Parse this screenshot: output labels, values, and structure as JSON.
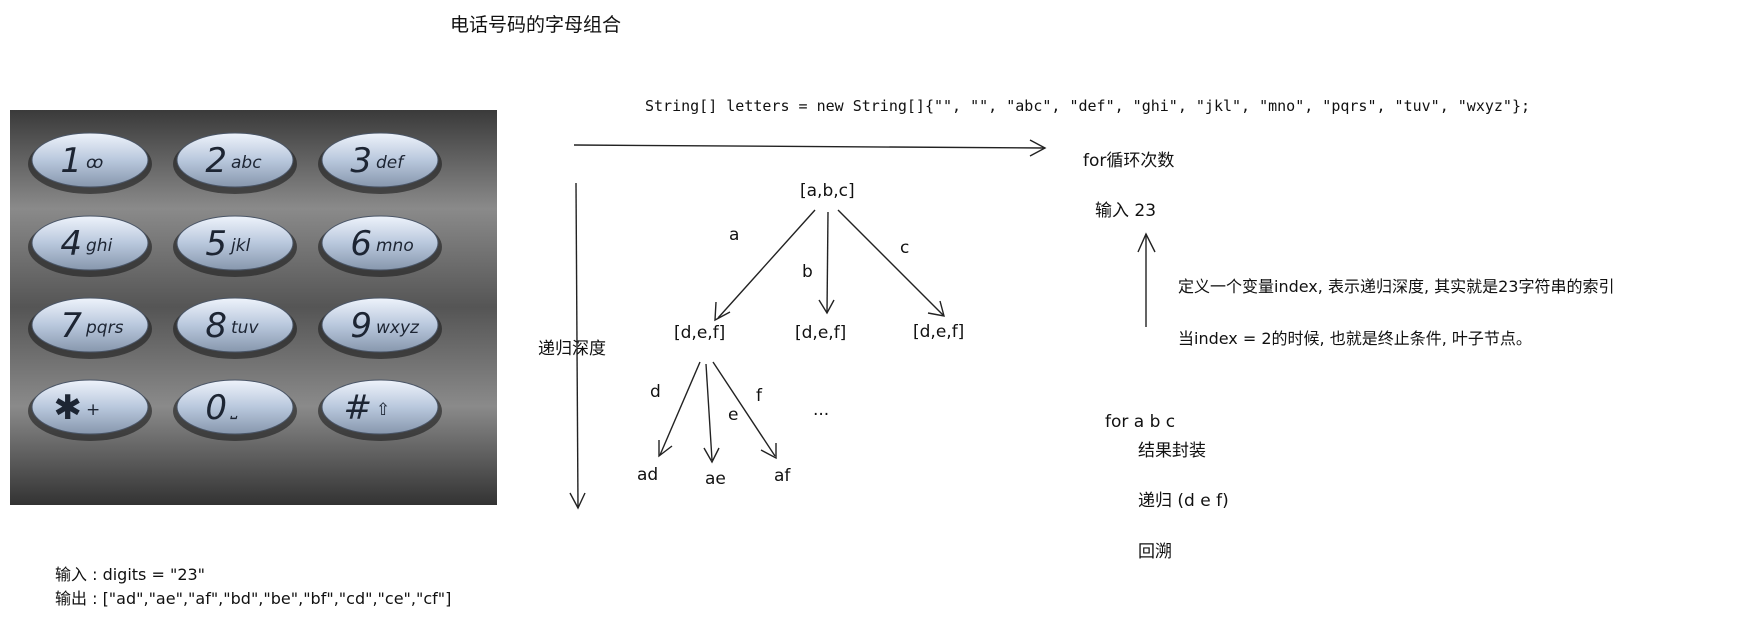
{
  "title": "电话号码的字母组合",
  "code_line": "String[] letters = new String[]{\"\", \"\", \"abc\", \"def\", \"ghi\", \"jkl\", \"mno\", \"pqrs\", \"tuv\", \"wxyz\"};",
  "loop_label": "for循环次数",
  "depth_label": "递归深度",
  "keypad": [
    {
      "digit": "1",
      "sub": "ꝏ"
    },
    {
      "digit": "2",
      "sub": "abc"
    },
    {
      "digit": "3",
      "sub": "def"
    },
    {
      "digit": "4",
      "sub": "ghi"
    },
    {
      "digit": "5",
      "sub": "jkl"
    },
    {
      "digit": "6",
      "sub": "mno"
    },
    {
      "digit": "7",
      "sub": "pqrs"
    },
    {
      "digit": "8",
      "sub": "tuv"
    },
    {
      "digit": "9",
      "sub": "wxyz"
    },
    {
      "digit": "✱",
      "sub": "+"
    },
    {
      "digit": "0",
      "sub": "⎵"
    },
    {
      "digit": "#",
      "sub": "⇧"
    }
  ],
  "tree": {
    "root": "[a,b,c]",
    "level1_edges": [
      "a",
      "b",
      "c"
    ],
    "level1_nodes": [
      "[d,e,f]",
      "[d,e,f]",
      "[d,e,f]"
    ],
    "level2_edges": [
      "d",
      "e",
      "f"
    ],
    "level2_nodes": [
      "ad",
      "ae",
      "af"
    ],
    "ellipsis": "..."
  },
  "notes": {
    "input_23": "输入 23",
    "define_index": "定义一个变量index, 表示递归深度, 其实就是23字符串的索引",
    "terminate": "当index = 2的时候, 也就是终止条件, 叶子节点。",
    "for_abc": "for  a b c",
    "collect": "结果封装",
    "recurse": "递归  (d e f)",
    "backtrack": "回溯"
  },
  "example": {
    "input": "输入 : digits = \"23\"",
    "output": "输出 : [\"ad\",\"ae\",\"af\",\"bd\",\"be\",\"bf\",\"cd\",\"ce\",\"cf\"]"
  }
}
